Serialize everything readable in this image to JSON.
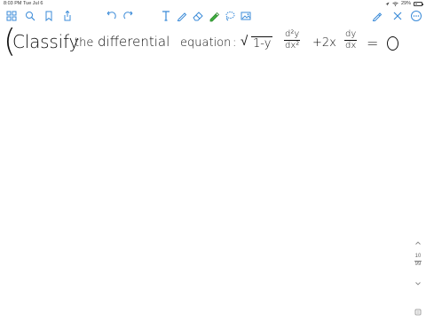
{
  "status": {
    "time": "8:03 PM",
    "date": "Tue Jul 6",
    "battery_percent": "29%",
    "battery_level": 0.29,
    "icons": [
      "location-icon",
      "wifi-icon",
      "battery-icon"
    ]
  },
  "toolbar": {
    "left_icons": [
      "grid-icon",
      "search-icon",
      "bookmark-icon",
      "share-icon"
    ],
    "center_icons": [
      "undo-icon",
      "redo-icon"
    ],
    "tools": [
      {
        "name": "text-tool-icon",
        "color": "#3b8bd8"
      },
      {
        "name": "pen-tool-icon",
        "color": "#3b8bd8"
      },
      {
        "name": "eraser-tool-icon",
        "color": "#3b8bd8"
      },
      {
        "name": "highlighter-tool-icon",
        "color": "#3eae3e"
      },
      {
        "name": "lasso-tool-icon",
        "color": "#3b8bd8"
      },
      {
        "name": "image-tool-icon",
        "color": "#3b8bd8"
      }
    ],
    "right_icons": [
      "edit-mode-icon",
      "close-icon",
      "more-icon"
    ]
  },
  "note": {
    "bracket": "(",
    "word_classify": "Classify",
    "word_the": "the",
    "word_differential": "differential",
    "word_equation": "equation",
    "colon": ":",
    "sqrt_symbol": "√",
    "radicand": "1-y",
    "frac1_num": "d²y",
    "frac1_den": "dx²",
    "plus_2x": "+2x",
    "frac2_num": "dy",
    "frac2_den": "dx",
    "equals": "="
  },
  "pager": {
    "current": "10",
    "total": "99"
  }
}
